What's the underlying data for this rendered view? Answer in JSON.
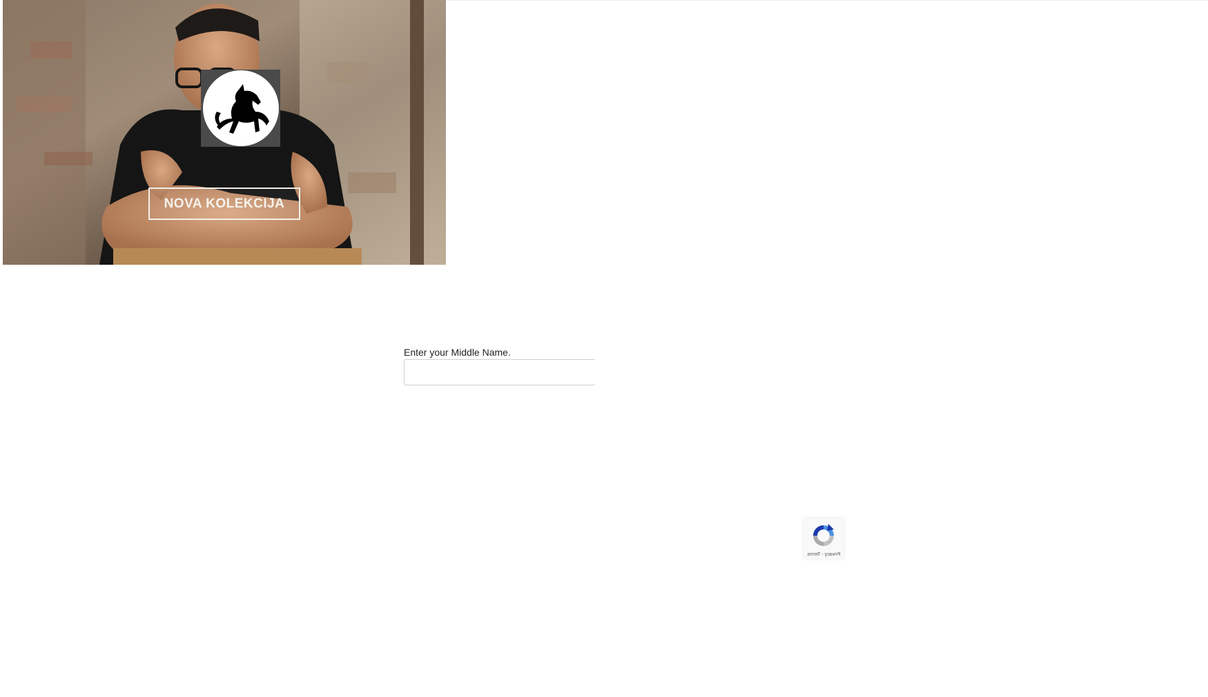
{
  "banner": {
    "button_label": "NOVA KOLEKCIJA",
    "logo_icon": "horse-icon",
    "photo": "man-with-glasses-brick-wall-photo"
  },
  "form": {
    "middle_name_label": "Enter your Middle Name.",
    "middle_name_value": "",
    "middle_name_placeholder": ""
  },
  "recaptcha": {
    "links_text": "Privacy - Terms",
    "icon": "recaptcha-icon"
  },
  "colors": {
    "background": "#ffffff",
    "banner_button_text": "#f6f2ec",
    "input_border": "#cfcfcf"
  }
}
